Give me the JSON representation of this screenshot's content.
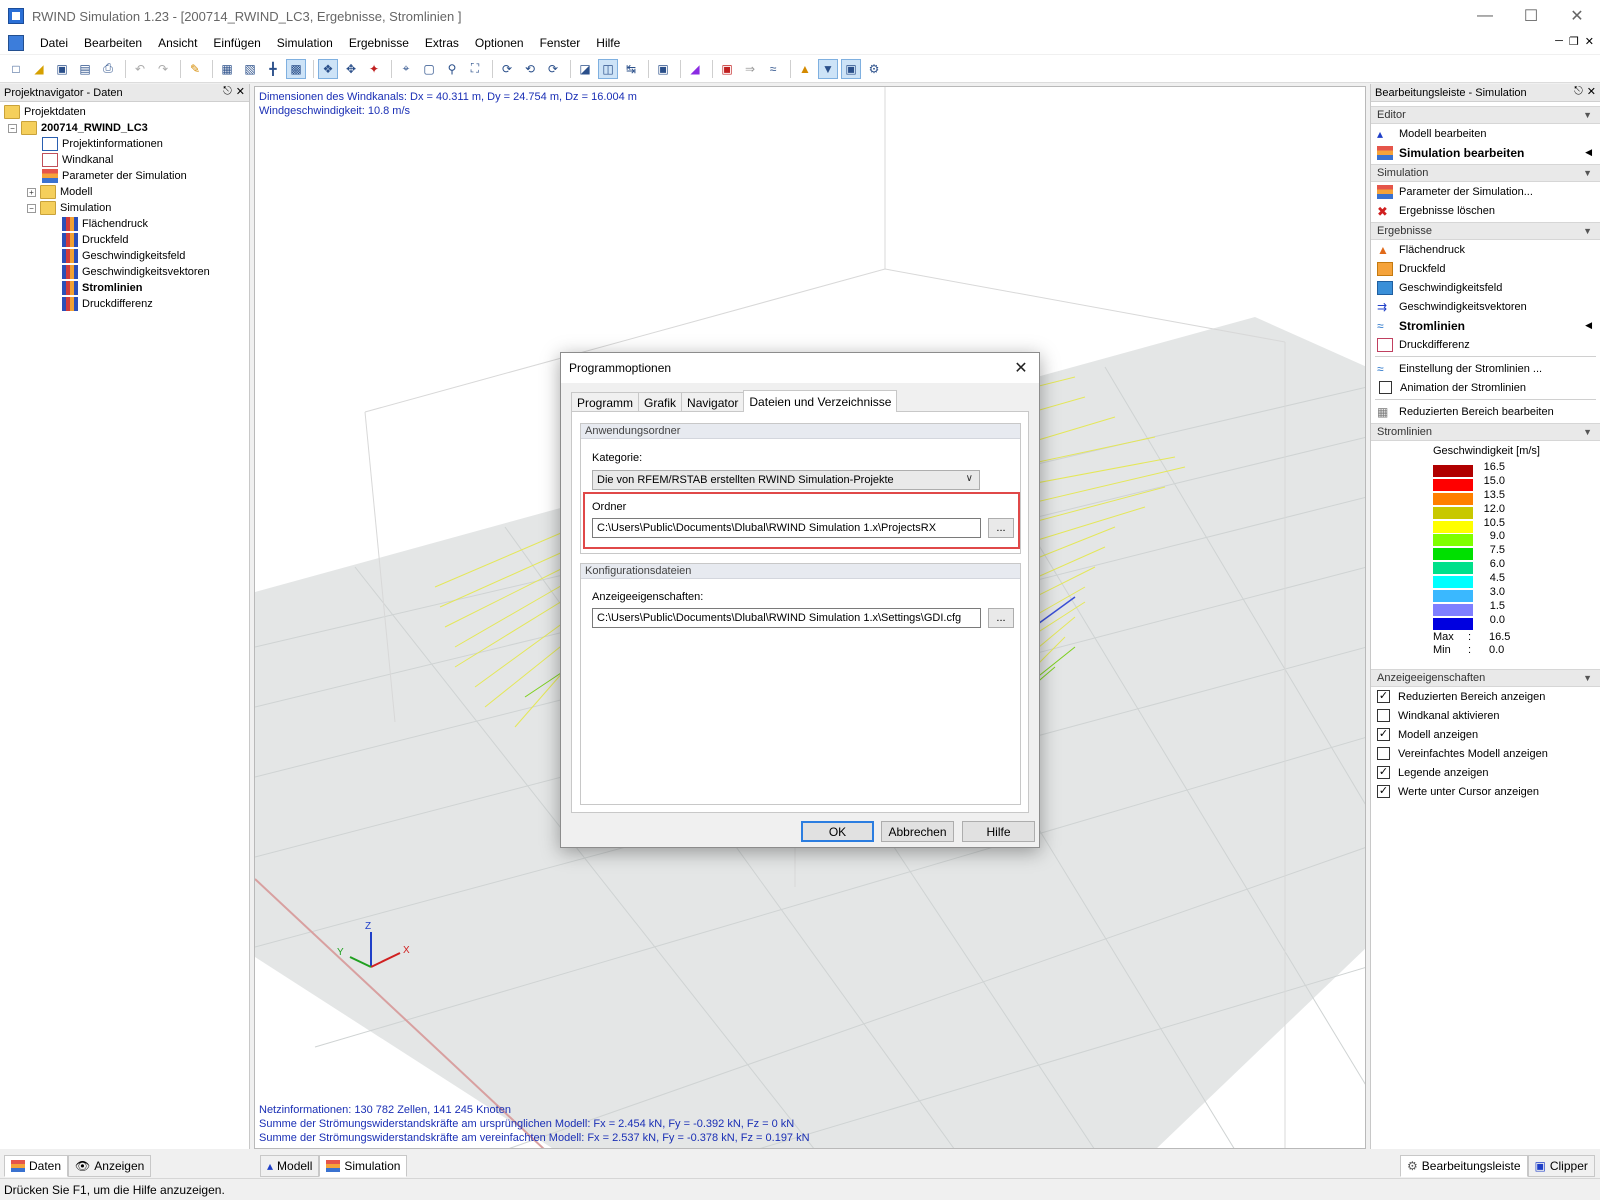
{
  "window": {
    "title": "RWIND Simulation 1.23 - [200714_RWIND_LC3, Ergebnisse, Stromlinien ]"
  },
  "menu": [
    "Datei",
    "Bearbeiten",
    "Ansicht",
    "Einfügen",
    "Simulation",
    "Ergebnisse",
    "Extras",
    "Optionen",
    "Fenster",
    "Hilfe"
  ],
  "navigator": {
    "title": "Projektnavigator - Daten",
    "root": "Projektdaten",
    "project": "200714_RWIND_LC3",
    "items": {
      "projektinfo": "Projektinformationen",
      "windkanal": "Windkanal",
      "parameter": "Parameter der Simulation",
      "modell": "Modell",
      "simulation": "Simulation",
      "flaechendruck": "Flächendruck",
      "druckfeld": "Druckfeld",
      "geschwindigkeitsfeld": "Geschwindigkeitsfeld",
      "geschwindigkeitsvektoren": "Geschwindigkeitsvektoren",
      "stromlinien": "Stromlinien",
      "druckdifferenz": "Druckdifferenz"
    },
    "tabs": {
      "daten": "Daten",
      "anzeigen": "Anzeigen"
    }
  },
  "viewport": {
    "info1": "Dimensionen des Windkanals: Dx = 40.311 m, Dy = 24.754 m, Dz = 16.004 m",
    "info2": "Windgeschwindigkeit: 10.8 m/s",
    "bottom1": "Netzinformationen: 130 782 Zellen, 141 245 Knoten",
    "bottom2": "Summe der Strömungswiderstandskräfte am ursprünglichen Modell: Fx = 2.454 kN, Fy = -0.392 kN, Fz = 0 kN",
    "bottom3": "Summe der Strömungswiderstandskräfte am vereinfachten Modell: Fx = 2.537 kN, Fy = -0.378 kN, Fz = 0.197 kN",
    "axes": {
      "z": "Z",
      "y": "Y",
      "x": "X"
    },
    "tabs": {
      "modell": "Modell",
      "simulation": "Simulation"
    }
  },
  "rightpanel": {
    "title": "Bearbeitungsleiste - Simulation",
    "editor": {
      "header": "Editor",
      "modell": "Modell bearbeiten",
      "simulation": "Simulation bearbeiten"
    },
    "simulation": {
      "header": "Simulation",
      "parameter": "Parameter der Simulation...",
      "loeschen": "Ergebnisse löschen"
    },
    "ergebnisse": {
      "header": "Ergebnisse",
      "flaechendruck": "Flächendruck",
      "druckfeld": "Druckfeld",
      "geschwindigkeitsfeld": "Geschwindigkeitsfeld",
      "geschwindigkeitsvektoren": "Geschwindigkeitsvektoren",
      "stromlinien": "Stromlinien",
      "druckdifferenz": "Druckdifferenz",
      "einstellung": "Einstellung der Stromlinien ...",
      "animation": "Animation der Stromlinien",
      "reduziert": "Reduzierten Bereich bearbeiten"
    },
    "stromlinien": {
      "header": "Stromlinien",
      "legend_title": "Geschwindigkeit [m/s]",
      "legend_values": [
        "16.5",
        "15.0",
        "13.5",
        "12.0",
        "10.5",
        "9.0",
        "7.5",
        "6.0",
        "4.5",
        "3.0",
        "1.5",
        "0.0"
      ],
      "legend_colors": [
        "#b00000",
        "#ff0000",
        "#ff7f00",
        "#c8c800",
        "#ffff00",
        "#7fff00",
        "#00e000",
        "#00e08a",
        "#00ffff",
        "#3ab8ff",
        "#7f7fff",
        "#0000e0"
      ],
      "max_label": "Max",
      "min_label": "Min",
      "sep": ":",
      "max_value": "16.5",
      "min_value": "0.0"
    },
    "anzeige": {
      "header": "Anzeigeeigenschaften",
      "reduziert": "Reduzierten Bereich anzeigen",
      "windkanal": "Windkanal aktivieren",
      "modell": "Modell anzeigen",
      "vereinfacht": "Vereinfachtes Modell anzeigen",
      "legende": "Legende anzeigen",
      "werte": "Werte unter Cursor anzeigen"
    },
    "tabs": {
      "bearbeitungsleiste": "Bearbeitungsleiste",
      "clipper": "Clipper"
    }
  },
  "dialog": {
    "title": "Programmoptionen",
    "tabs": [
      "Programm",
      "Grafik",
      "Navigator",
      "Dateien und Verzeichnisse"
    ],
    "group1": "Anwendungsordner",
    "kategorie_label": "Kategorie:",
    "kategorie_value": "Die von RFEM/RSTAB erstellten RWIND Simulation-Projekte",
    "ordner_label": "Ordner",
    "ordner_value": "C:\\Users\\Public\\Documents\\Dlubal\\RWIND Simulation 1.x\\ProjectsRX",
    "browse": "...",
    "group2": "Konfigurationsdateien",
    "anzeige_label": "Anzeigeeigenschaften:",
    "anzeige_value": "C:\\Users\\Public\\Documents\\Dlubal\\RWIND Simulation 1.x\\Settings\\GDI.cfg",
    "ok": "OK",
    "cancel": "Abbrechen",
    "help": "Hilfe"
  },
  "status": "Drücken Sie F1, um die Hilfe anzuzeigen."
}
